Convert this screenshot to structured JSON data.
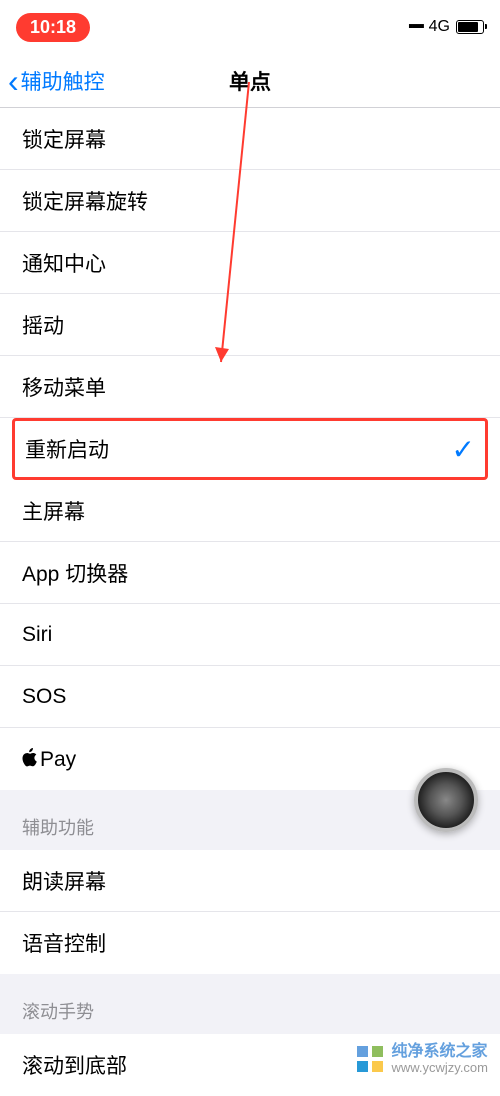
{
  "statusbar": {
    "time": "10:18",
    "network": "4G"
  },
  "nav": {
    "back_label": "辅助触控",
    "title": "单点"
  },
  "group1": {
    "items": [
      {
        "label": "锁定屏幕",
        "selected": false
      },
      {
        "label": "锁定屏幕旋转",
        "selected": false
      },
      {
        "label": "通知中心",
        "selected": false
      },
      {
        "label": "摇动",
        "selected": false
      },
      {
        "label": "移动菜单",
        "selected": false
      },
      {
        "label": "重新启动",
        "selected": true
      },
      {
        "label": "主屏幕",
        "selected": false
      },
      {
        "label": "App 切换器",
        "selected": false
      },
      {
        "label": "Siri",
        "selected": false
      },
      {
        "label": "SOS",
        "selected": false
      },
      {
        "label": "Pay",
        "selected": false
      }
    ]
  },
  "section_a11y": {
    "header": "辅助功能",
    "items": [
      {
        "label": "朗读屏幕"
      },
      {
        "label": "语音控制"
      }
    ]
  },
  "section_scroll": {
    "header": "滚动手势",
    "items": [
      {
        "label": "滚动到底部"
      }
    ]
  },
  "watermark": {
    "line1": "纯净系统之家",
    "line2": "www.ycwjzy.com"
  }
}
